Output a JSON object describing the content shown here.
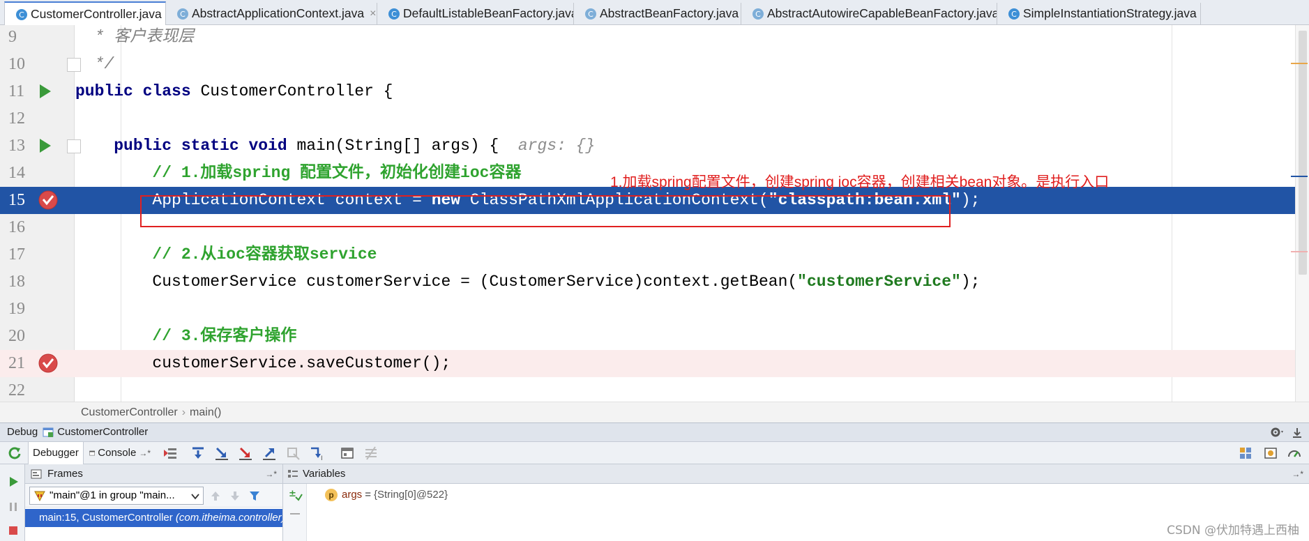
{
  "tabs": [
    {
      "label": "CustomerController.java",
      "active": true
    },
    {
      "label": "AbstractApplicationContext.java",
      "active": false
    },
    {
      "label": "DefaultListableBeanFactory.java",
      "active": false
    },
    {
      "label": "AbstractBeanFactory.java",
      "active": false
    },
    {
      "label": "AbstractAutowireCapableBeanFactory.java",
      "active": false
    },
    {
      "label": "SimpleInstantiationStrategy.java",
      "active": false
    }
  ],
  "tab_close_glyph": "×",
  "editor": {
    "lines": [
      {
        "num": "9",
        "gutter": "",
        "parts": [
          {
            "t": "  * 客户表现层",
            "c": "cmt-i"
          }
        ]
      },
      {
        "num": "10",
        "gutter": "fold",
        "parts": [
          {
            "t": "  */",
            "c": "cmt-i"
          }
        ]
      },
      {
        "num": "11",
        "gutter": "run",
        "parts": [
          {
            "t": "public class ",
            "c": "kw"
          },
          {
            "t": "CustomerController {",
            "c": ""
          }
        ]
      },
      {
        "num": "12",
        "gutter": "",
        "parts": []
      },
      {
        "num": "13",
        "gutter": "run-fold",
        "parts": [
          {
            "t": "    public static void ",
            "c": "kw"
          },
          {
            "t": "main(String[] args) {  ",
            "c": ""
          },
          {
            "t": "args: {}",
            "c": "hint"
          }
        ]
      },
      {
        "num": "14",
        "gutter": "",
        "parts": [
          {
            "t": "        // 1.加载spring 配置文件，初始化创建ioc容器",
            "c": "cmt-g"
          }
        ]
      },
      {
        "num": "15",
        "gutter": "breakpoint",
        "highlight": "current",
        "parts": [
          {
            "t": "        ApplicationContext context = ",
            "c": ""
          },
          {
            "t": "new ",
            "c": "kw"
          },
          {
            "t": "ClassPathXmlApplicationContext(",
            "c": ""
          },
          {
            "t": "\"classpath:bean.xml\"",
            "c": "str"
          },
          {
            "t": ");",
            "c": ""
          }
        ]
      },
      {
        "num": "16",
        "gutter": "",
        "parts": []
      },
      {
        "num": "17",
        "gutter": "",
        "parts": [
          {
            "t": "        // 2.从ioc容器获取service",
            "c": "cmt-g"
          }
        ]
      },
      {
        "num": "18",
        "gutter": "",
        "parts": [
          {
            "t": "        CustomerService customerService = (CustomerService)context.getBean(",
            "c": ""
          },
          {
            "t": "\"customerService\"",
            "c": "str"
          },
          {
            "t": ");",
            "c": ""
          }
        ]
      },
      {
        "num": "19",
        "gutter": "",
        "parts": []
      },
      {
        "num": "20",
        "gutter": "",
        "parts": [
          {
            "t": "        // 3.保存客户操作",
            "c": "cmt-g"
          }
        ]
      },
      {
        "num": "21",
        "gutter": "breakpoint",
        "highlight": "breakpoint",
        "parts": [
          {
            "t": "        customerService.saveCustomer();",
            "c": ""
          }
        ]
      },
      {
        "num": "22",
        "gutter": "",
        "parts": []
      }
    ],
    "annotation": "1.加载spring配置文件，创建spring ioc容器，创建相关bean对象。是执行入口"
  },
  "breadcrumb": {
    "items": [
      "CustomerController",
      "main()"
    ],
    "separator": "›"
  },
  "debug": {
    "title": "Debug",
    "config_name": "CustomerController",
    "tabs": {
      "debugger": "Debugger",
      "console": "Console"
    },
    "console_pin": "→*",
    "frames_label": "Frames",
    "frames_pin": "→*",
    "thread": "\"main\"@1 in group \"main...",
    "frame": {
      "method": "main:15, CustomerController ",
      "package": "(com.itheima.controller)"
    },
    "variables_label": "Variables",
    "variables_pin": "→*",
    "variables": [
      {
        "badge": "p",
        "name": "args",
        "eq": "=",
        "value": "{String[0]@522}"
      }
    ]
  },
  "watermark": "CSDN @伏加特遇上西柚",
  "colors": {
    "current_line": "#2154a5",
    "breakpoint_line": "#fbecec",
    "annotation": "#e01e1e",
    "keyword": "#000080",
    "comment_green": "#2fa32f",
    "string": "#1f7a1f",
    "selected_frame": "#2f65ca"
  }
}
